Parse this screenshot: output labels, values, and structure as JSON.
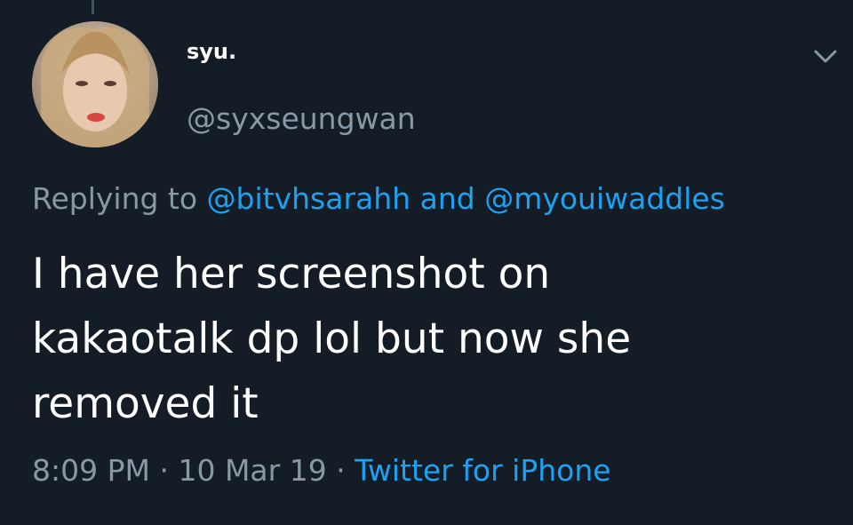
{
  "tweet": {
    "user": {
      "display_name": "syu.",
      "handle": "@syxseungwan",
      "avatar": "profile-photo"
    },
    "reply": {
      "prefix": "Replying to",
      "mention_1": "@bitvhsarahh",
      "conjunction": "and",
      "mention_2": "@myouiwaddles"
    },
    "text": "I have her screenshot on\nkakaotalk dp lol but now she\nremoved it",
    "time": "8:09 PM",
    "date": "10 Mar 19",
    "separator": "·",
    "source": "Twitter for iPhone",
    "menu_icon": "chevron-down-icon"
  },
  "colors": {
    "background": "#141d26",
    "text_primary": "#ffffff",
    "text_secondary": "#8899a6",
    "accent": "#1da1f2"
  }
}
